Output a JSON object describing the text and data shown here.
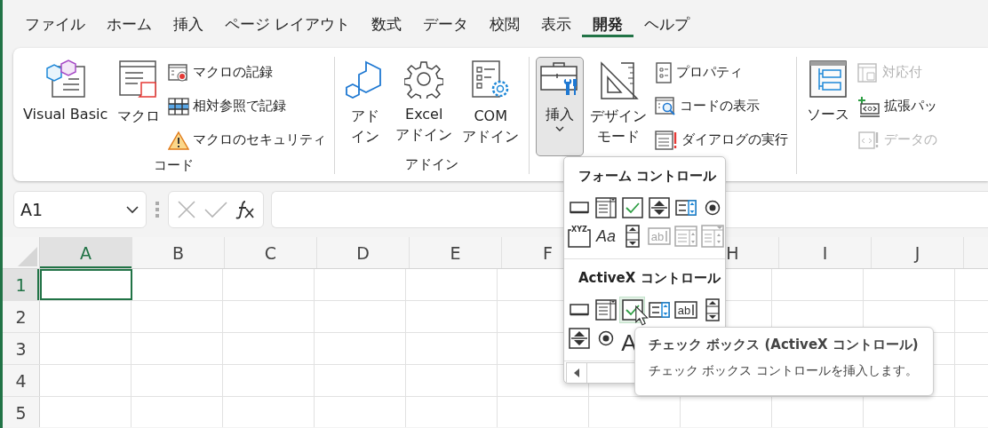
{
  "menu_tabs": [
    {
      "label": "ファイル",
      "selected": false
    },
    {
      "label": "ホーム",
      "selected": false
    },
    {
      "label": "挿入",
      "selected": false
    },
    {
      "label": "ページ レイアウト",
      "selected": false
    },
    {
      "label": "数式",
      "selected": false
    },
    {
      "label": "データ",
      "selected": false
    },
    {
      "label": "校閲",
      "selected": false
    },
    {
      "label": "表示",
      "selected": false
    },
    {
      "label": "開発",
      "selected": true
    },
    {
      "label": "ヘルプ",
      "selected": false
    }
  ],
  "ribbon": {
    "groups": [
      {
        "label": "コード",
        "items": [
          {
            "kind": "large",
            "label": "Visual Basic"
          },
          {
            "kind": "large",
            "label": "マクロ"
          },
          {
            "kind": "stack",
            "items": [
              {
                "label": "マクロの記録",
                "disabled": false
              },
              {
                "label": "相対参照で記録",
                "disabled": false
              },
              {
                "label": "マクロのセキュリティ",
                "disabled": false
              }
            ]
          }
        ]
      },
      {
        "label": "アドイン",
        "items": [
          {
            "kind": "large",
            "label": "アドイン"
          },
          {
            "kind": "large",
            "label": "Excel アドイン"
          },
          {
            "kind": "large",
            "label": "COM アドイン"
          }
        ]
      },
      {
        "items": [
          {
            "kind": "dropdown",
            "label": "挿入",
            "expanded": true
          },
          {
            "kind": "large",
            "label": "デザインモード"
          },
          {
            "kind": "stack",
            "items": [
              {
                "label": "プロパティ",
                "disabled": false
              },
              {
                "label": "コードの表示",
                "disabled": false
              },
              {
                "label": "ダイアログの実行",
                "disabled": false
              }
            ]
          }
        ]
      },
      {
        "items": [
          {
            "kind": "large",
            "label": "ソース"
          },
          {
            "kind": "stack",
            "items": [
              {
                "label": "対応付",
                "disabled": true
              },
              {
                "label": "拡張パッ",
                "disabled": false
              },
              {
                "label": "データの",
                "disabled": true
              }
            ]
          }
        ]
      }
    ]
  },
  "formula_bar": {
    "name_box": "A1"
  },
  "sheet": {
    "columns": [
      {
        "label": "A",
        "selected": true
      },
      {
        "label": "B",
        "selected": false
      },
      {
        "label": "C",
        "selected": false
      },
      {
        "label": "D",
        "selected": false
      },
      {
        "label": "E",
        "selected": false
      },
      {
        "label": "F",
        "selected": false
      },
      null,
      {
        "label": "H",
        "selected": false
      },
      {
        "label": "I",
        "selected": false
      },
      {
        "label": "J",
        "selected": false
      },
      null
    ],
    "rows": [
      {
        "label": "1",
        "selected": true
      },
      {
        "label": "2",
        "selected": false
      },
      {
        "label": "3",
        "selected": false
      },
      {
        "label": "4",
        "selected": false
      },
      {
        "label": "5",
        "selected": false
      }
    ]
  },
  "controls_menu": {
    "sections": [
      {
        "title": "フォーム コントロール",
        "items": [
          {
            "kind": "button",
            "disabled": false,
            "highlighted": false
          },
          {
            "kind": "combo",
            "disabled": false,
            "highlighted": false
          },
          {
            "kind": "checkbox",
            "disabled": false,
            "highlighted": false
          },
          {
            "kind": "spin",
            "disabled": false,
            "highlighted": false
          },
          {
            "kind": "list",
            "disabled": false,
            "highlighted": false
          },
          {
            "kind": "radio",
            "disabled": false,
            "highlighted": false
          },
          {
            "kind": "group",
            "glyph": "XYZ",
            "disabled": false,
            "highlighted": false
          },
          {
            "kind": "label",
            "glyph": "Aa",
            "disabled": false,
            "highlighted": false
          },
          {
            "kind": "scroll",
            "disabled": false,
            "highlighted": false
          },
          {
            "kind": "textbox",
            "glyph": "ab",
            "disabled": true,
            "highlighted": false
          },
          {
            "kind": "listcombo",
            "disabled": true,
            "highlighted": false
          },
          {
            "kind": "dropcombo",
            "disabled": true,
            "highlighted": false
          }
        ]
      },
      {
        "title": "ActiveX コントロール",
        "items": [
          {
            "kind": "button",
            "disabled": false,
            "highlighted": false
          },
          {
            "kind": "combo",
            "disabled": false,
            "highlighted": false
          },
          {
            "kind": "checkbox",
            "disabled": false,
            "highlighted": true
          },
          {
            "kind": "list",
            "disabled": false,
            "highlighted": false
          },
          {
            "kind": "textbox",
            "glyph": "ab",
            "disabled": false,
            "highlighted": false
          },
          {
            "kind": "scroll",
            "disabled": false,
            "highlighted": false
          },
          {
            "kind": "spin",
            "disabled": false,
            "highlighted": false
          },
          {
            "kind": "radio",
            "disabled": false,
            "highlighted": false
          },
          {
            "kind": "biglabel",
            "glyph": "A",
            "disabled": false,
            "highlighted": false
          }
        ]
      }
    ]
  },
  "tooltip": {
    "title": "チェック ボックス (ActiveX コントロール)",
    "description": "チェック ボックス コントロールを挿入します。"
  }
}
